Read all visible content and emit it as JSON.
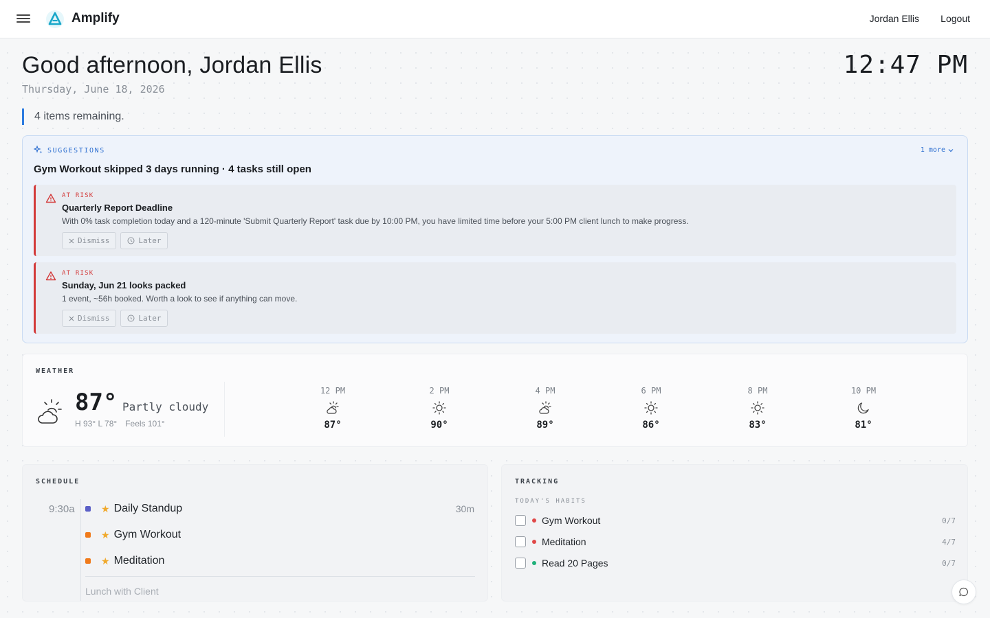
{
  "app": {
    "brand": "Amplify",
    "user": "Jordan Ellis",
    "logout": "Logout"
  },
  "header": {
    "greeting": "Good afternoon, Jordan Ellis",
    "date": "Thursday, June 18, 2026",
    "clock": "12:47 PM",
    "remaining": "4 items remaining."
  },
  "suggestions": {
    "label": "SUGGESTIONS",
    "more": "1 more",
    "title": "Gym Workout skipped 3 days running · 4 tasks still open",
    "alerts": [
      {
        "tag": "AT RISK",
        "title": "Quarterly Report Deadline",
        "body": "With 0% task completion today and a 120-minute 'Submit Quarterly Report' task due by 10:00 PM, you have limited time before your 5:00 PM client lunch to make progress.",
        "dismiss": "Dismiss",
        "later": "Later"
      },
      {
        "tag": "AT RISK",
        "title": "Sunday, Jun 21 looks packed",
        "body": "1 event, ~56h booked. Worth a look to see if anything can move.",
        "dismiss": "Dismiss",
        "later": "Later"
      }
    ]
  },
  "weather": {
    "label": "WEATHER",
    "temp": "87°",
    "condition": "Partly cloudy",
    "hilo": "H 93° L 78°",
    "feels": "Feels 101°",
    "hourly": [
      {
        "time": "12 PM",
        "icon": "partly-cloudy-icon",
        "temp": "87°"
      },
      {
        "time": "2 PM",
        "icon": "sun-icon",
        "temp": "90°"
      },
      {
        "time": "4 PM",
        "icon": "partly-cloudy-icon",
        "temp": "89°"
      },
      {
        "time": "6 PM",
        "icon": "sun-icon",
        "temp": "86°"
      },
      {
        "time": "8 PM",
        "icon": "sun-icon",
        "temp": "83°"
      },
      {
        "time": "10 PM",
        "icon": "moon-icon",
        "temp": "81°"
      }
    ]
  },
  "schedule": {
    "label": "SCHEDULE",
    "time": "9:30a",
    "duration": "30m",
    "events": [
      {
        "title": "Daily Standup",
        "color": "#5b5fc7"
      },
      {
        "title": "Gym Workout",
        "color": "#f07a1a"
      },
      {
        "title": "Meditation",
        "color": "#f07a1a"
      }
    ],
    "fade_text": "Lunch with Client"
  },
  "tracking": {
    "label": "TRACKING",
    "sublabel": "TODAY'S HABITS",
    "habits": [
      {
        "name": "Gym Workout",
        "count": "0/7",
        "color": "#e04848"
      },
      {
        "name": "Meditation",
        "count": "4/7",
        "color": "#e04848"
      },
      {
        "name": "Read 20 Pages",
        "count": "0/7",
        "color": "#20b07a"
      }
    ]
  },
  "colors": {
    "accent": "#2d7be0",
    "risk": "#d33a3a",
    "star": "#f0a92c"
  }
}
